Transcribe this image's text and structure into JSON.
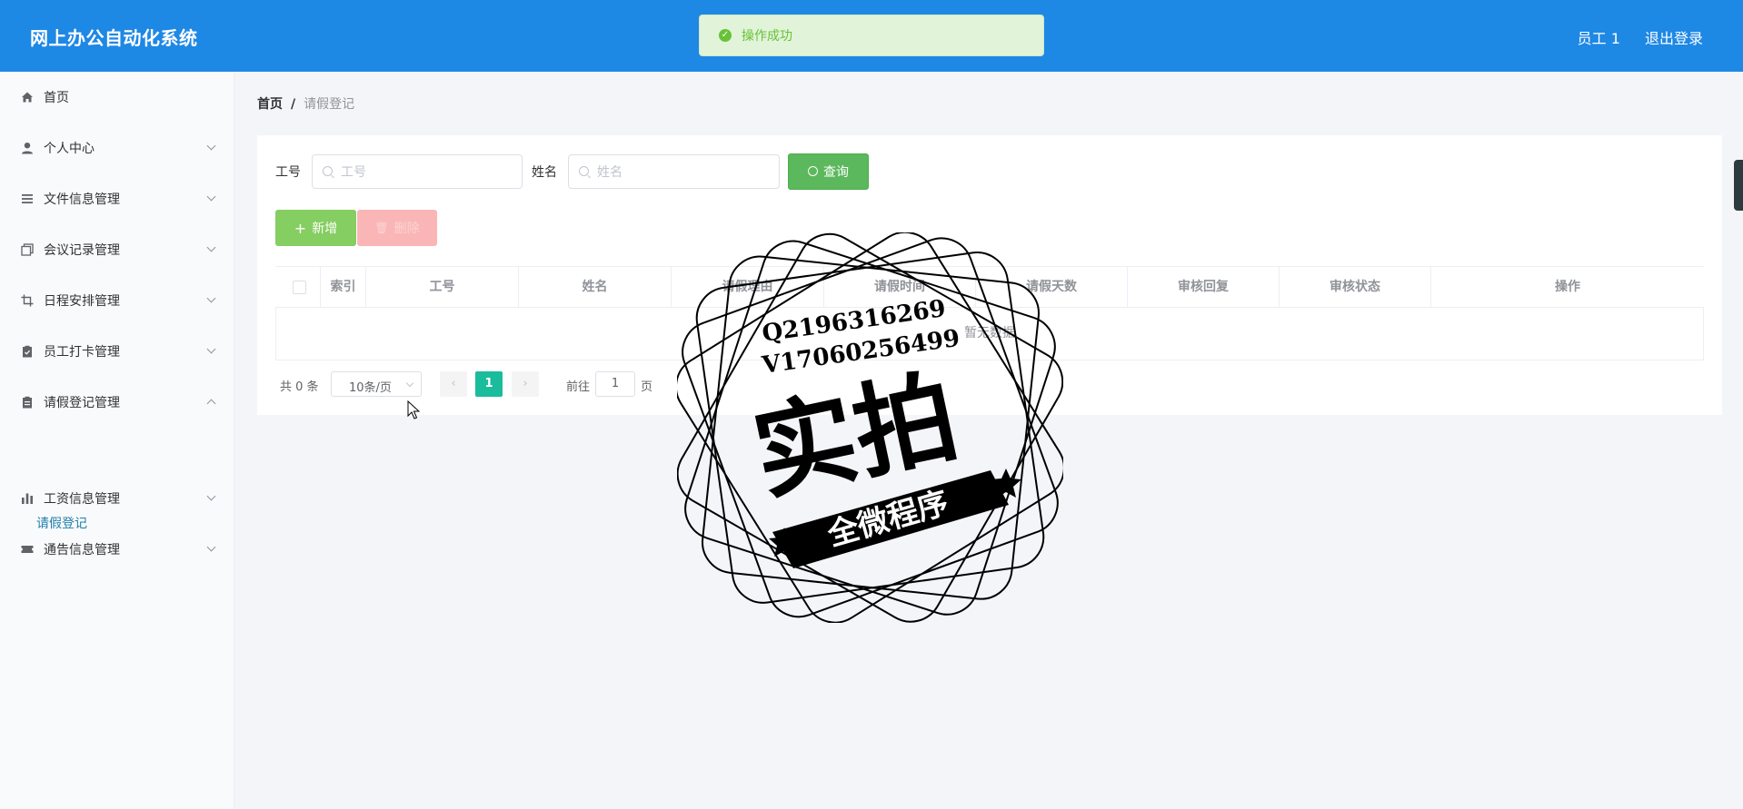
{
  "header": {
    "title": "网上办公自动化系统",
    "user": "员工 1",
    "logout": "退出登录"
  },
  "toast": {
    "message": "操作成功"
  },
  "sidebar": {
    "items": [
      {
        "label": "首页",
        "icon": "home-icon"
      },
      {
        "label": "个人中心",
        "icon": "user-icon"
      },
      {
        "label": "文件信息管理",
        "icon": "list-icon"
      },
      {
        "label": "会议记录管理",
        "icon": "copy-icon"
      },
      {
        "label": "日程安排管理",
        "icon": "crop-icon"
      },
      {
        "label": "员工打卡管理",
        "icon": "clipboard-icon"
      },
      {
        "label": "请假登记管理",
        "icon": "document-icon"
      },
      {
        "label": "工资信息管理",
        "icon": "bar-chart-icon"
      },
      {
        "label": "通告信息管理",
        "icon": "ticket-icon"
      }
    ],
    "sub_item": "请假登记"
  },
  "breadcrumb": {
    "home": "首页",
    "separator": "/",
    "current": "请假登记"
  },
  "search": {
    "id_label": "工号",
    "id_placeholder": "工号",
    "name_label": "姓名",
    "name_placeholder": "姓名",
    "query_button": "查询"
  },
  "actions": {
    "add": "新增",
    "delete": "删除"
  },
  "table": {
    "columns": [
      "索引",
      "工号",
      "姓名",
      "请假理由",
      "请假时间",
      "请假天数",
      "审核回复",
      "审核状态",
      "操作"
    ],
    "empty_text": "暂无数据"
  },
  "pagination": {
    "total": "共 0 条",
    "page_size": "10条/页",
    "current_page": "1",
    "goto_label": "前往",
    "goto_value": "1",
    "page_unit": "页"
  },
  "watermark": {
    "qq": "Q2196316269",
    "wechat": "V17060256499",
    "main": "实拍",
    "ribbon": "全微程序"
  },
  "colors": {
    "header_bg": "#1e88e5",
    "success_bg": "#e1f3d8",
    "success_text": "#67c23a",
    "query_btn": "#5cb85c",
    "add_btn": "#85ce61",
    "delete_btn": "#fab6b6",
    "active_sub": "#1f7fa8",
    "current_page": "#1abc9c"
  }
}
